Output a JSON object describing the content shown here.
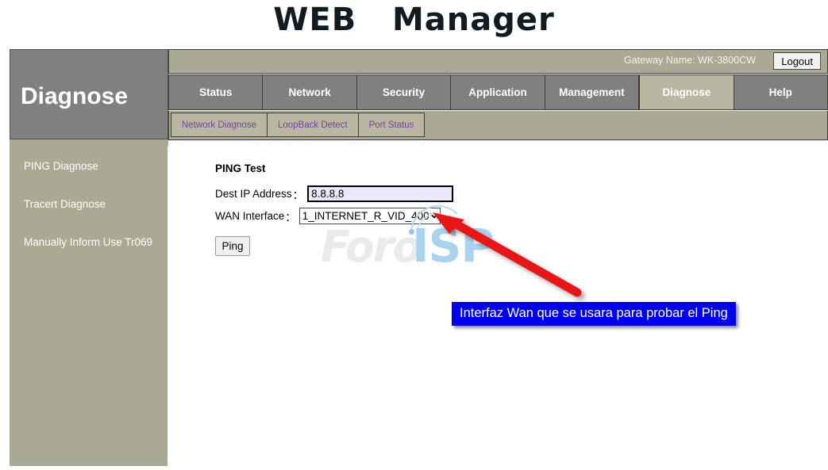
{
  "banner": {
    "title": "WEB   Manager"
  },
  "header": {
    "gateway_label": "Gateway Name: WK-3800CW",
    "logout_label": "Logout"
  },
  "sidebar": {
    "title": "Diagnose",
    "items": [
      {
        "label": "PING Diagnose"
      },
      {
        "label": "Tracert Diagnose"
      },
      {
        "label": "Manually Inform Use Tr069"
      }
    ]
  },
  "nav": {
    "tabs": [
      {
        "label": "Status",
        "active": false
      },
      {
        "label": "Network",
        "active": false
      },
      {
        "label": "Security",
        "active": false
      },
      {
        "label": "Application",
        "active": false
      },
      {
        "label": "Management",
        "active": false
      },
      {
        "label": "Diagnose",
        "active": true
      },
      {
        "label": "Help",
        "active": false
      }
    ]
  },
  "subnav": {
    "items": [
      {
        "label": "Network Diagnose"
      },
      {
        "label": "LoopBack Detect"
      },
      {
        "label": "Port Status"
      }
    ]
  },
  "main": {
    "section_title": "PING Test",
    "dest_ip": {
      "label": "Dest IP Address",
      "colon": "：",
      "value": "8.8.8.8",
      "placeholder": ""
    },
    "wan_interface": {
      "label": "WAN Interface",
      "colon": "：",
      "selected": "1_INTERNET_R_VID_400",
      "arrow": "⌄"
    },
    "ping_button": "Ping"
  },
  "watermark": {
    "part1": "Foro",
    "part2": "ISP"
  },
  "annotation": {
    "callout_text": "Interfaz Wan que se usara para probar el Ping",
    "arrow_color": "#e81818",
    "callout_bg": "#0000ee",
    "callout_fg": "#ffffff"
  },
  "colors": {
    "tab_bg": "#808080",
    "tab_active_bg": "#b9b7a1",
    "khaki": "#aaa994",
    "subnav_link": "#7a3fa0"
  }
}
